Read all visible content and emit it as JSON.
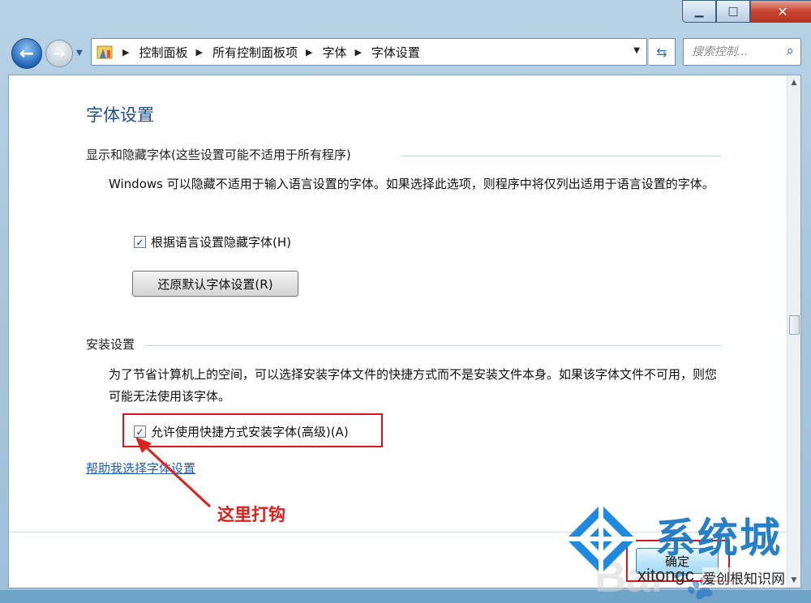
{
  "window": {
    "caption_buttons": {
      "minimize": "▁",
      "maximize": "□",
      "close": "✕"
    }
  },
  "nav": {
    "breadcrumb": [
      "控制面板",
      "所有控制面板项",
      "字体",
      "字体设置"
    ],
    "search_placeholder": "搜索控制..."
  },
  "page": {
    "title": "字体设置",
    "section1": {
      "heading": "显示和隐藏字体(这些设置可能不适用于所有程序)",
      "description": "Windows 可以隐藏不适用于输入语言设置的字体。如果选择此选项，则程序中将仅列出适用于语言设置的字体。",
      "checkbox_label": "根据语言设置隐藏字体(H)",
      "checkbox_checked": true,
      "restore_button": "还原默认字体设置(R)"
    },
    "section2": {
      "heading": "安装设置",
      "description": "为了节省计算机上的空间，可以选择安装字体文件的快捷方式而不是安装文件本身。如果该字体文件不可用，则您可能无法使用该字体。",
      "checkbox_label": "允许使用快捷方式安装字体(高级)(A)",
      "checkbox_checked": true
    },
    "help_link": "帮助我选择字体设置",
    "ok_button": "确定"
  },
  "annotation": {
    "text": "这里打钩",
    "color": "#e0201a"
  },
  "watermark": {
    "brand": "系统城",
    "url": "xitongc",
    "site": "爱创根知识网"
  },
  "colors": {
    "title_blue": "#1e4e9a",
    "link_blue": "#1d5cc7",
    "highlight_red": "#d8141c"
  }
}
